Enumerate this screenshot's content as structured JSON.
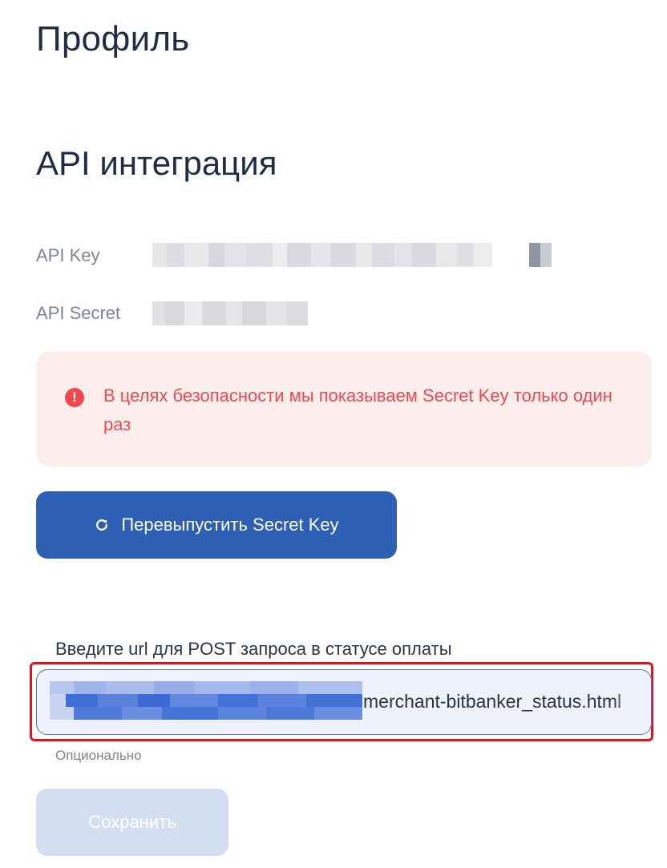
{
  "page": {
    "title": "Профиль"
  },
  "api": {
    "section_title": "API интеграция",
    "key_label": "API Key",
    "secret_label": "API Secret"
  },
  "alert": {
    "icon": "exclamation-circle-icon",
    "text": "В целях безопасности мы показываем Secret Key только один раз",
    "color": "#f0484d",
    "background": "#fdeeee"
  },
  "reissue": {
    "label": "Перевыпустить Secret Key",
    "icon": "refresh-icon",
    "color": "#2d5fb5"
  },
  "url_field": {
    "label": "Введите url для POST запроса в статусе оплаты",
    "value_visible": "merchant-bitbanker_status.html",
    "helper": "Опционально"
  },
  "save": {
    "label": "Сохранить",
    "color": "#d3dff1"
  }
}
